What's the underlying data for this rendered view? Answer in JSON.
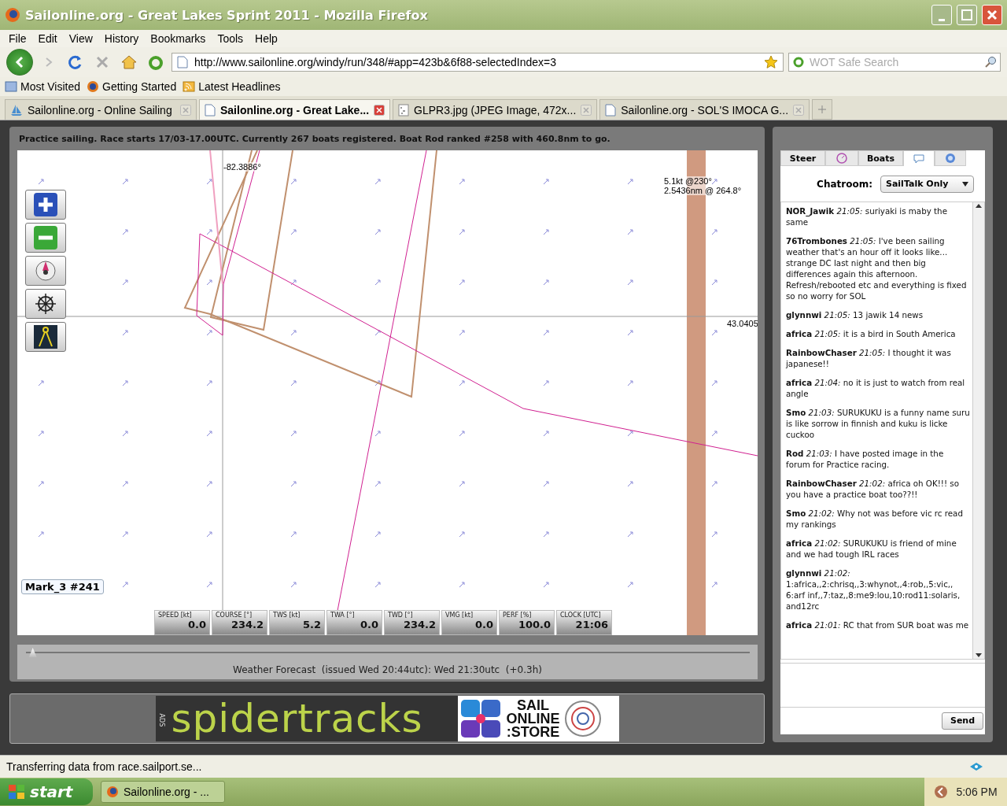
{
  "window": {
    "title": "Sailonline.org - Great Lakes Sprint 2011 - Mozilla Firefox"
  },
  "menu": [
    "File",
    "Edit",
    "View",
    "History",
    "Bookmarks",
    "Tools",
    "Help"
  ],
  "address": {
    "value": "http://www.sailonline.org/windy/run/348/#app=423b&6f88-selectedIndex=3"
  },
  "search": {
    "placeholder": "WOT Safe Search"
  },
  "bookmarks": [
    {
      "kind": "feed-list",
      "label": "Most Visited"
    },
    {
      "kind": "globe",
      "label": "Getting Started"
    },
    {
      "kind": "rss",
      "label": "Latest Headlines"
    }
  ],
  "browser_tabs": [
    {
      "kind": "boat",
      "label": "Sailonline.org - Online Sailing",
      "selected": false
    },
    {
      "kind": "page",
      "label": "Sailonline.org - Great Lake...",
      "selected": true
    },
    {
      "kind": "image",
      "label": "GLPR3.jpg (JPEG Image, 472x...",
      "selected": false
    },
    {
      "kind": "page",
      "label": "Sailonline.org - SOL'S IMOCA G...",
      "selected": false
    }
  ],
  "race_info": "Practice sailing. Race starts 17/03-17.00UTC. Currently 267 boats registered. Boat Rod ranked #258 with 460.8nm to go.",
  "map": {
    "longitude": "-82.3886°",
    "latitude": "43.0405",
    "wind": "5.1kt @230°",
    "distance": "2.5436nm @ 264.8°",
    "mark": "Mark_3 #241"
  },
  "instruments": [
    {
      "label": "SPEED [kt]",
      "value": "0.0"
    },
    {
      "label": "COURSE [°]",
      "value": "234.2"
    },
    {
      "label": "TWS [kt]",
      "value": "5.2"
    },
    {
      "label": "TWA [°]",
      "value": "0.0"
    },
    {
      "label": "TWD [°]",
      "value": "234.2"
    },
    {
      "label": "VMG [kt]",
      "value": "0.0"
    },
    {
      "label": "PERF [%]",
      "value": "100.0"
    },
    {
      "label": "CLOCK [UTC]",
      "value": "21:06"
    }
  ],
  "forecast": {
    "level": 0.01,
    "text": "Weather Forecast  (issued Wed 20:44utc): Wed 21:30utc  (+0.3h)"
  },
  "ads": {
    "tag": "ADS",
    "brand": "spidertracks",
    "store": [
      "SAIL",
      "ONLINE",
      ":STORE"
    ]
  },
  "panel_tabs": [
    {
      "kind": "text",
      "label": "Steer",
      "selected": false
    },
    {
      "kind": "icon",
      "selected": false
    },
    {
      "kind": "text",
      "label": "Boats",
      "selected": false
    },
    {
      "kind": "icon",
      "selected": true
    },
    {
      "kind": "icon",
      "selected": false
    }
  ],
  "chatroom": {
    "label": "Chatroom:",
    "value": "SailTalk Only"
  },
  "messages": [
    {
      "user": "NOR_Jawik",
      "time": "21:05:",
      "text": "suriyaki is maby the same"
    },
    {
      "user": "76Trombones",
      "time": "21:05:",
      "text": "I've been sailing weather that's an hour off it looks like... strange DC last night and then big differences again this afternoon. Refresh/rebooted etc and everything is fixed so no worry for SOL"
    },
    {
      "user": "glynnwi",
      "time": "21:05:",
      "text": "13 jawik 14 news"
    },
    {
      "user": "africa",
      "time": "21:05:",
      "text": "it is a bird in South America"
    },
    {
      "user": "RainbowChaser",
      "time": "21:05:",
      "text": "I thought it was japanese!!"
    },
    {
      "user": "africa",
      "time": "21:04:",
      "text": "no it is just to watch from real angle"
    },
    {
      "user": "Smo",
      "time": "21:03:",
      "text": "SURUKUKU is a funny name suru is like sorrow in finnish and kuku is licke cuckoo"
    },
    {
      "user": "Rod",
      "time": "21:03:",
      "text": "I have posted image in the forum for Practice racing."
    },
    {
      "user": "RainbowChaser",
      "time": "21:02:",
      "text": "africa oh OK!!! so you have a practice boat too??!!"
    },
    {
      "user": "Smo",
      "time": "21:02:",
      "text": "Why not was before vic rc read my rankings"
    },
    {
      "user": "africa",
      "time": "21:02:",
      "text": "SURUKUKU is friend of mine and we had tough IRL races"
    },
    {
      "user": "glynnwi",
      "time": "21:02:",
      "text": "1:africa,,2:chrisq,,3:whynot,,4:rob,,5:vic,, 6:arf inf,,7:taz,,8:me9:lou,10:rod11:solaris, and12rc"
    },
    {
      "user": "africa",
      "time": "21:01:",
      "text": "RC that from SUR boat was me"
    }
  ],
  "send": "Send",
  "status_bar": "Transferring data from race.sailport.se...",
  "taskbar": {
    "start": "start",
    "window": "Sailonline.org - ...",
    "clock": "5:06 PM"
  }
}
